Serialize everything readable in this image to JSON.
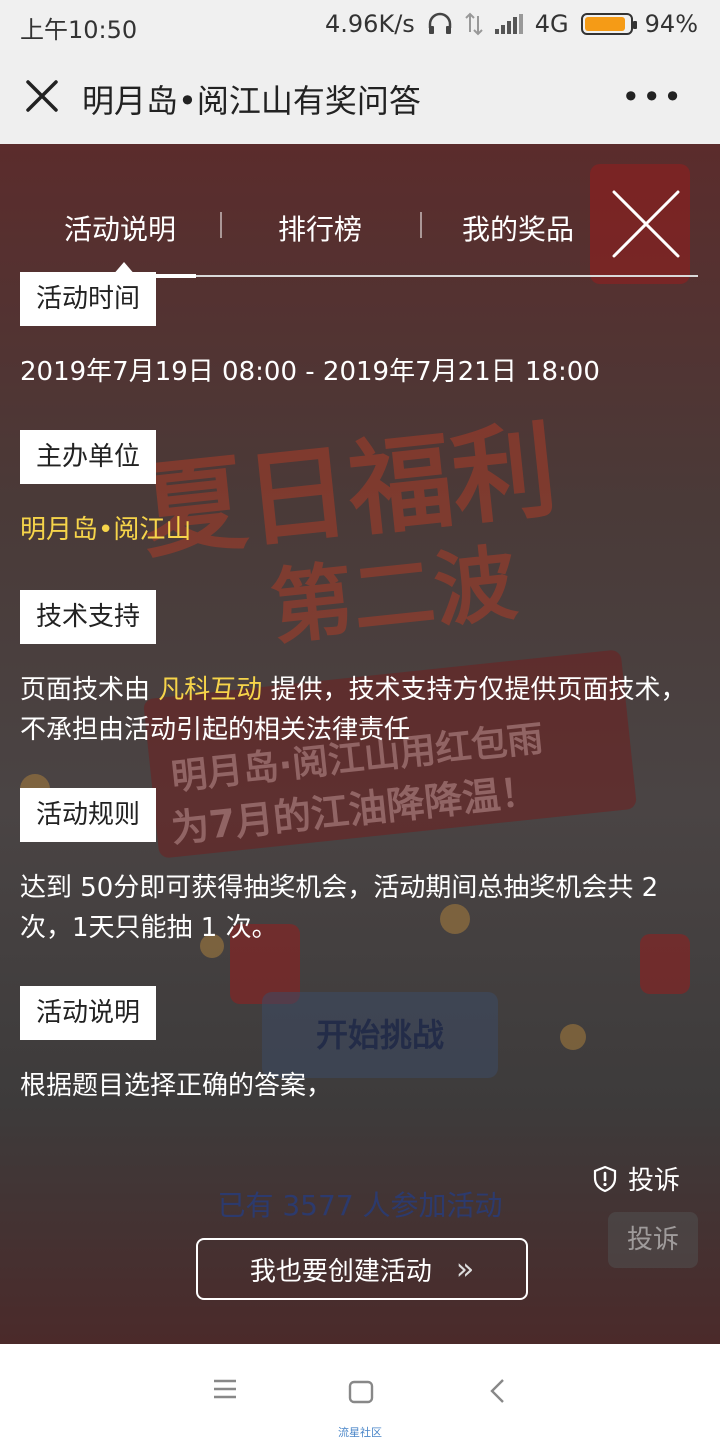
{
  "status_bar": {
    "time": "上午10:50",
    "net_speed": "4.96K/s",
    "network": "4G",
    "battery": "94%",
    "battery_level": 0.94,
    "battery_color": "#f59b16"
  },
  "nav": {
    "title": "明月岛•阅江山有奖问答",
    "more": "•••"
  },
  "tabs": [
    {
      "label": "活动说明",
      "active": true
    },
    {
      "label": "排行榜",
      "active": false
    },
    {
      "label": "我的奖品",
      "active": false
    }
  ],
  "background": {
    "line1": "夏日福利",
    "line2": "第二波",
    "line3": "明月岛·阅江山用红包雨",
    "line4": "为7月的江油降降温！"
  },
  "sections": {
    "time": {
      "label": "活动时间",
      "text": "2019年7月19日 08:00 - 2019年7月21日 18:00"
    },
    "organizer": {
      "label": "主办单位",
      "text": "明月岛•阅江山"
    },
    "tech": {
      "label": "技术支持",
      "prefix": "页面技术由 ",
      "highlight": "凡科互动",
      "suffix": " 提供，技术支持方仅提供页面技术，不承担由活动引起的相关法律责任"
    },
    "rules": {
      "label": "活动规则",
      "text": "达到 50分即可获得抽奖机会，活动期间总抽奖机会共 2 次，1天只能抽 1 次。"
    },
    "desc": {
      "label": "活动说明",
      "text": "根据题目选择正确的答案，"
    }
  },
  "start_button": "开始挑战",
  "participants": "已有 3577 人参加活动",
  "report": "投诉",
  "create_button": {
    "label": "我也要创建活动",
    "arrow": "»"
  },
  "accent_color": "#f6d44a",
  "watermark": "流星社区"
}
